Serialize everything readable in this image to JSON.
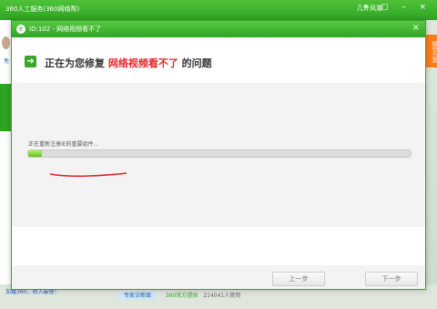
{
  "app": {
    "title": "360人工服务(360网络帮)",
    "user": "几许风潮",
    "controls": "▾ ◻ – ×",
    "side_tab": "提交方案",
    "fav_link": "加载360，收入最慢！",
    "bottom_tab": "专家诊断面",
    "bottom_official": "360官方提供",
    "bottom_count": "214041人使用",
    "left_link": "免"
  },
  "dialog": {
    "title": "ID:102 - 网络视频看不了",
    "close_label": "×",
    "logo": "e",
    "heading_prefix": "正在为您修复 ",
    "heading_highlight": "网络视频看不了",
    "heading_suffix": " 的问题",
    "status_text": "正在重新注册IE的重要组件...",
    "progress_fraction": 0.035,
    "prev_button": "上一步",
    "next_button": "下一步"
  },
  "colors": {
    "accent": "#2fa423",
    "highlight": "#e3262b",
    "annotation": "#d9232a"
  }
}
